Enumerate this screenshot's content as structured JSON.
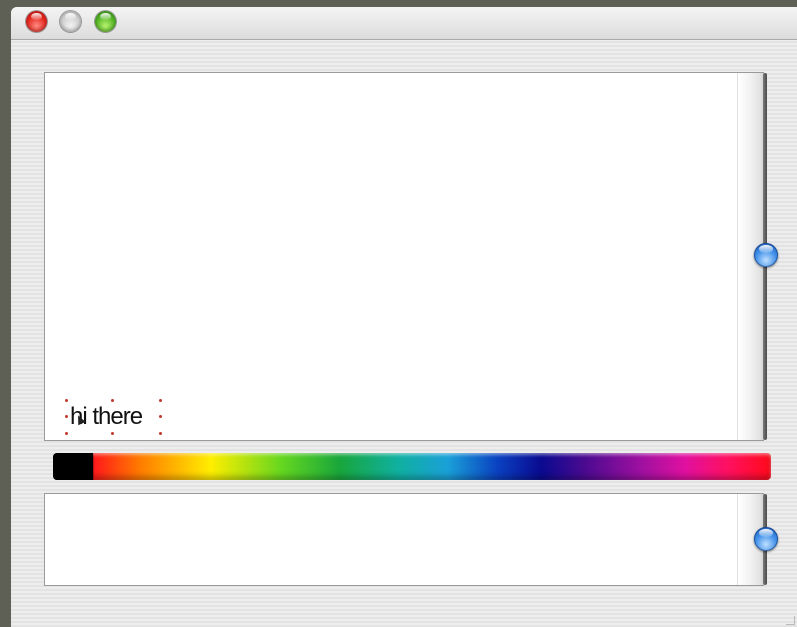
{
  "window": {
    "controls": [
      "close-button",
      "minimize-button",
      "zoom-button"
    ]
  },
  "canvas": {
    "text_item": "hi there",
    "scroll_position": 0.5
  },
  "color_picker": {
    "selected_color": "#000000"
  },
  "lower_panel": {
    "scroll_position": 0.5
  }
}
